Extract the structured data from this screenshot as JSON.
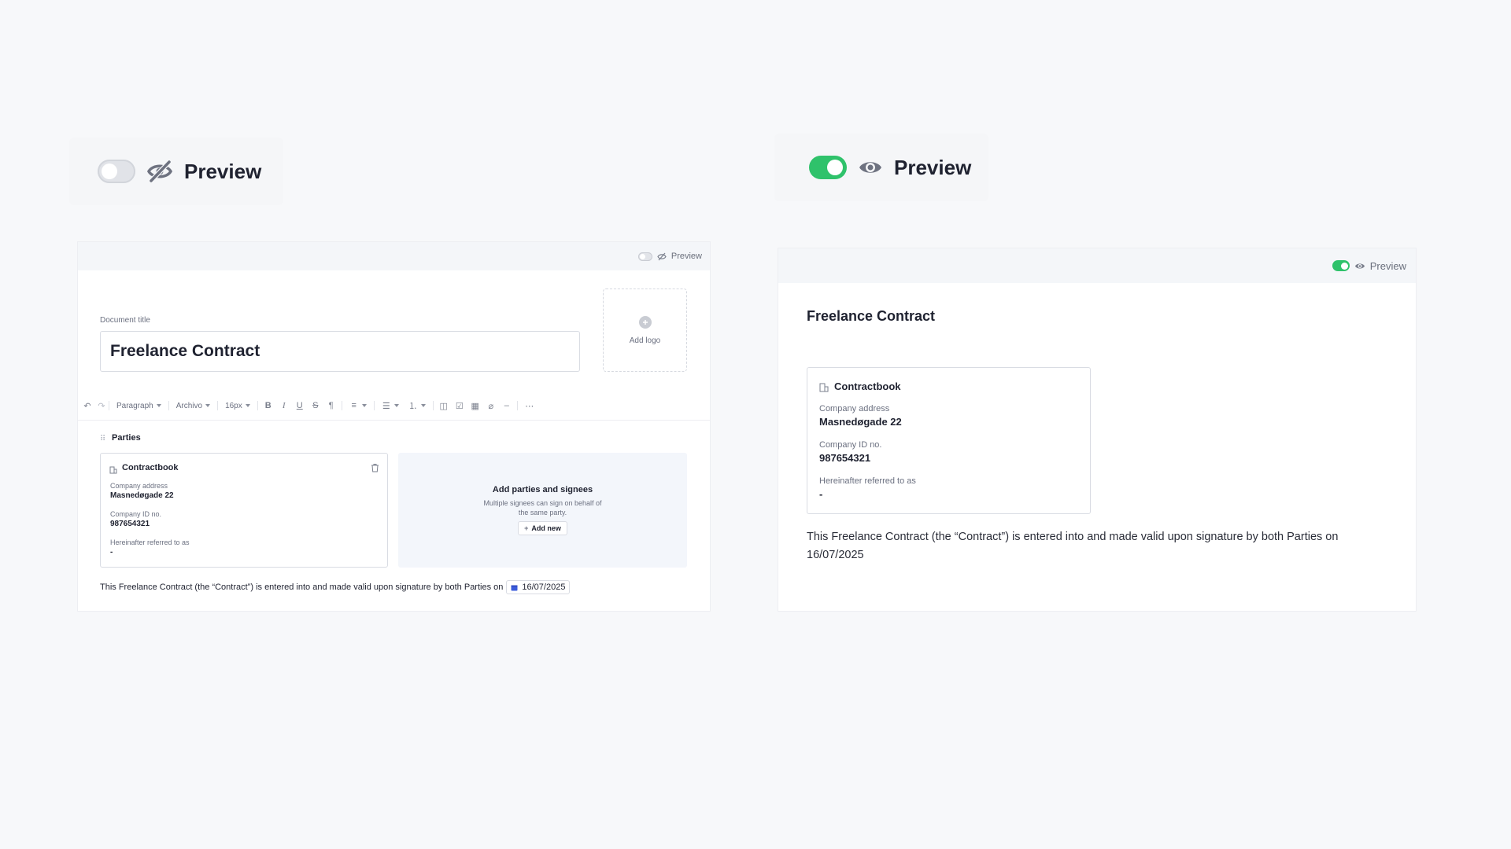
{
  "preview_off": {
    "label": "Preview",
    "toggle_state": "off"
  },
  "preview_on": {
    "label": "Preview",
    "toggle_state": "on"
  },
  "editor": {
    "preview_label": "Preview",
    "doc_title_label": "Document title",
    "doc_title_value": "Freelance Contract",
    "add_logo_label": "Add logo",
    "toolbar": {
      "block_type": "Paragraph",
      "font": "Archivo",
      "font_size": "16px"
    },
    "section_label": "Parties",
    "party": {
      "name": "Contractbook",
      "address_label": "Company address",
      "address_value": "Masnedøgade 22",
      "id_label": "Company ID no.",
      "id_value": "987654321",
      "ref_label": "Hereinafter referred to as",
      "ref_value": "-"
    },
    "add_parties": {
      "title": "Add parties and signees",
      "desc_line1": "Multiple signees can sign on behalf of",
      "desc_line2": "the same party.",
      "button": "Add new"
    },
    "body_text": "This Freelance Contract (the “Contract”) is entered into and made valid upon signature by both Parties on",
    "date": "16/07/2025"
  },
  "preview": {
    "preview_label": "Preview",
    "title": "Freelance Contract",
    "party": {
      "name": "Contractbook",
      "address_label": "Company address",
      "address_value": "Masnedøgade 22",
      "id_label": "Company ID no.",
      "id_value": "987654321",
      "ref_label": "Hereinafter referred to as",
      "ref_value": "-"
    },
    "body_line1": "This Freelance Contract (the “Contract”) is entered into and made valid upon signature by both Parties on",
    "body_line2": "16/07/2025"
  },
  "colors": {
    "toggle_on": "#2fc26b",
    "toggle_off": "#e1e3e8",
    "background": "#f7f8fa",
    "date_icon": "#3b5bdb"
  }
}
